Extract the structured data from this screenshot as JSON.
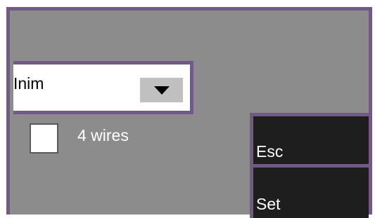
{
  "dropdown": {
    "selected_value": "Inim",
    "arrow_icon": "triangle-down-icon"
  },
  "checkbox": {
    "label": "4 wires",
    "checked": false
  },
  "buttons": {
    "esc_label": "Esc",
    "set_label": "Set"
  },
  "colors": {
    "frame": "#715b86",
    "background": "#8c8c8c",
    "button_bg": "#1e1e1e"
  }
}
